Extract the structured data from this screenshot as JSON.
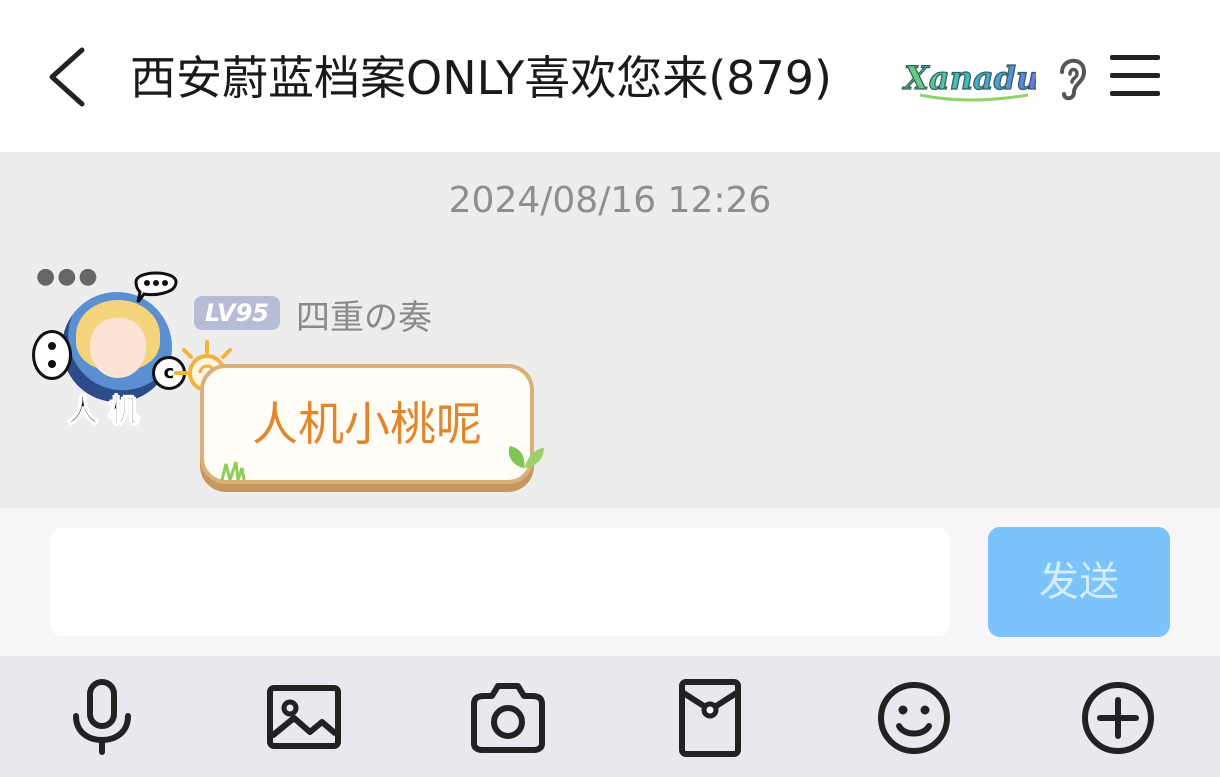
{
  "header": {
    "title": "西安蔚蓝档案ONLY喜欢您来(879)",
    "logo_text": "Xanadu",
    "icons": [
      "back-icon",
      "ear-icon",
      "menu-icon"
    ]
  },
  "chat": {
    "timestamp": "2024/08/16 12:26",
    "messages": [
      {
        "level_badge": "LV95",
        "sender": "四重の奏",
        "avatar_tag": "人 机",
        "text": "人机小桃呢"
      }
    ]
  },
  "input": {
    "value": "",
    "send_label": "发送"
  },
  "toolbar": {
    "items": [
      "microphone-icon",
      "image-icon",
      "camera-icon",
      "red-packet-icon",
      "emoji-icon",
      "plus-icon"
    ]
  },
  "colors": {
    "send_button": "#7ac4fb",
    "bubble_text": "#e2862e",
    "chat_background": "#ededed",
    "toolbar_background": "#e7e9ef"
  }
}
